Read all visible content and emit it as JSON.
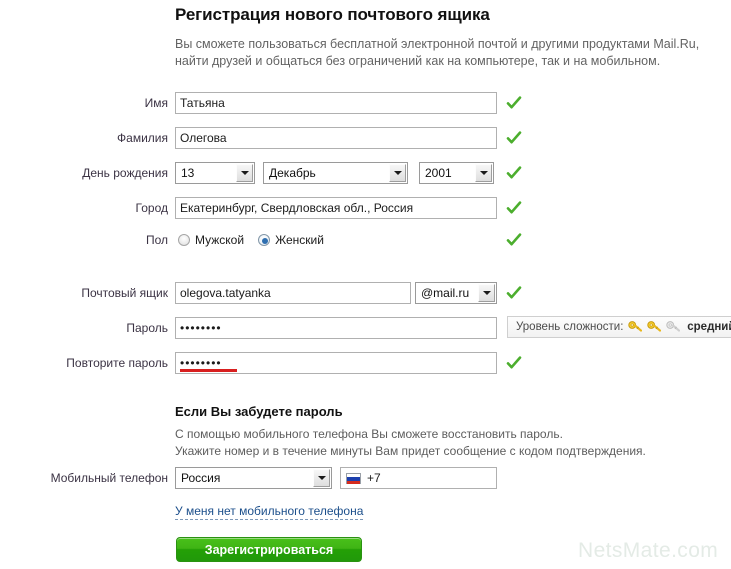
{
  "header": {
    "title": "Регистрация нового почтового ящика",
    "subtitle": "Вы сможете пользоваться бесплатной электронной почтой и другими продуктами Mail.Ru, найти друзей и общаться без ограничений как на компьютере, так и на мобильном."
  },
  "form": {
    "first_name": {
      "label": "Имя",
      "value": "Татьяна",
      "valid": "✓"
    },
    "last_name": {
      "label": "Фамилия",
      "value": "Олегова",
      "valid": "✓"
    },
    "birthday": {
      "label": "День рождения",
      "day": "13",
      "month": "Декабрь",
      "year": "2001",
      "valid": "✓"
    },
    "city": {
      "label": "Город",
      "value": "Екатеринбург, Свердловская обл., Россия",
      "valid": "✓"
    },
    "gender": {
      "label": "Пол",
      "male_label": "Мужской",
      "female_label": "Женский",
      "selected": "female",
      "valid": "✓"
    },
    "mailbox": {
      "label": "Почтовый ящик",
      "value": "olegova.tatyanka",
      "domain": "@mail.ru",
      "valid": "✓"
    },
    "password": {
      "label": "Пароль",
      "value": "••••••••",
      "strength_label": "Уровень сложности:",
      "strength_level": "средний",
      "keys_filled": 2,
      "keys_total": 3
    },
    "password_repeat": {
      "label": "Повторите пароль",
      "value": "••••••••",
      "valid": "✓"
    }
  },
  "recovery": {
    "heading": "Если Вы забудете пароль",
    "line1": "С помощью мобильного телефона Вы сможете восстановить пароль.",
    "line2": "Укажите номер и в течение минуты Вам придет сообщение с кодом подтверждения.",
    "phone_label": "Мобильный телефон",
    "country": "Россия",
    "code": "+7",
    "no_phone_link": "У меня нет мобильного телефона"
  },
  "submit_label": "Зарегистрироваться",
  "watermark": "NetsMate.com",
  "colors": {
    "accent_green": "#2ba80a",
    "check_green": "#4cae2e",
    "label": "#3b3344",
    "link": "#1c4f8b",
    "error_red": "#d81f1f",
    "key_gold": "#f5c518"
  }
}
